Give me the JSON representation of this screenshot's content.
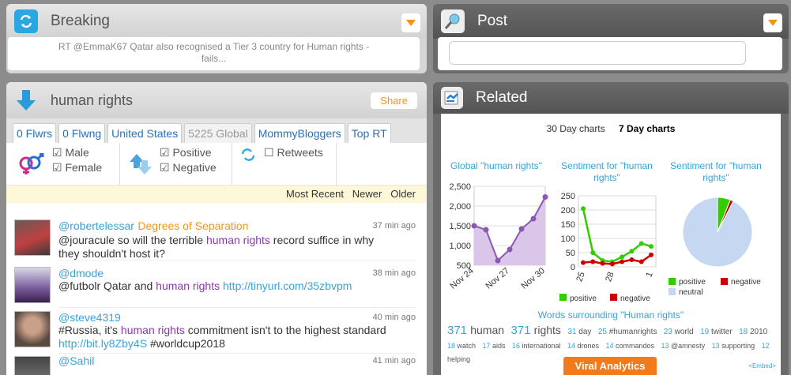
{
  "breaking": {
    "title": "Breaking",
    "text_line1": "RT @EmmaK67 Qatar also recognised a Tier 3 country for Human rights -",
    "text_line2": "fails..."
  },
  "post": {
    "title": "Post",
    "input_placeholder": ""
  },
  "stream": {
    "title": "human rights",
    "share": "Share",
    "tabs": [
      "0 Flwrs",
      "0 Flwng",
      "United States",
      "5225 Global",
      "MommyBloggers",
      "Top RT"
    ],
    "filters": {
      "male": "Male",
      "female": "Female",
      "positive": "Positive",
      "negative": "Negative",
      "retweets": "Retweets"
    },
    "sort": {
      "most_recent": "Most Recent",
      "newer": "Newer",
      "older": "Older"
    },
    "tweets": [
      {
        "user": "@robertelessar",
        "extra": "Degrees of Separation",
        "time": "37 min ago",
        "t1": "@jouracule so will the terrible ",
        "hl": "human rights",
        "t2": " record suffice in why",
        "line2": "they shouldn't host it?"
      },
      {
        "user": "@dmode",
        "time": "38 min ago",
        "t1": "@futbolr Qatar and ",
        "hl": "human rights",
        "link": "http://tinyurl.com/35zbvpm"
      },
      {
        "user": "@steve4319",
        "time": "40 min ago",
        "t1": "#Russia, it's ",
        "hl": "human rights",
        "t2": " commitment isn't to the highest standard",
        "link": "http://bit.ly8Zby4S",
        "t3": " #worldcup2018"
      },
      {
        "user": "@Sahil",
        "time": "41 min ago"
      }
    ]
  },
  "related": {
    "title": "Related",
    "tab_30": "30 Day charts",
    "tab_7": "7 Day charts",
    "words_title": "Words surrounding \"Human rights\"",
    "words": [
      {
        "n": "371",
        "w": "human",
        "size": "big"
      },
      {
        "n": "371",
        "w": "rights",
        "size": "big"
      },
      {
        "n": "31",
        "w": "day",
        "size": "med"
      },
      {
        "n": "25",
        "w": "#humanrights",
        "size": "med"
      },
      {
        "n": "23",
        "w": "world",
        "size": "med"
      },
      {
        "n": "19",
        "w": "twitter",
        "size": "med"
      },
      {
        "n": "18",
        "w": "2010",
        "size": "med"
      },
      {
        "n": "18",
        "w": "watch",
        "size": "sm"
      },
      {
        "n": "17",
        "w": "aids",
        "size": "sm"
      },
      {
        "n": "16",
        "w": "international",
        "size": "sm"
      },
      {
        "n": "14",
        "w": "drones",
        "size": "sm"
      },
      {
        "n": "14",
        "w": "commandos",
        "size": "sm"
      },
      {
        "n": "13",
        "w": "@amnesty",
        "size": "sm"
      },
      {
        "n": "13",
        "w": "supporting",
        "size": "sm"
      },
      {
        "n": "12",
        "w": "helping",
        "size": "sm"
      }
    ],
    "viral": "Viral Analytics",
    "embed": "<Embed>"
  },
  "chart_data": [
    {
      "type": "area",
      "title": "Global \"human rights\"",
      "x": [
        "Nov 24",
        "Nov 25",
        "Nov 26",
        "Nov 27",
        "Nov 28",
        "Nov 29",
        "Nov 30"
      ],
      "x_tick_labels": [
        "Nov 24",
        "Nov 27",
        "Nov 30"
      ],
      "values": [
        1500,
        1400,
        620,
        900,
        1420,
        1680,
        2230
      ],
      "ylim": [
        500,
        2500
      ],
      "yticks": [
        500,
        1000,
        1500,
        2000,
        2500
      ],
      "ytick_labels": [
        "500",
        "1,000",
        "1,500",
        "2,000",
        "2,500"
      ],
      "color": "#8e56b4"
    },
    {
      "type": "line",
      "title": "Sentiment for \"human rights\"",
      "x_tick_labels": [
        "25",
        "28",
        "1"
      ],
      "ylim": [
        0,
        250
      ],
      "yticks": [
        0,
        50,
        100,
        150,
        200,
        250
      ],
      "series": [
        {
          "name": "positive",
          "color": "#33cc00",
          "values": [
            205,
            50,
            22,
            18,
            35,
            55,
            82,
            72
          ]
        },
        {
          "name": "negative",
          "color": "#cc0000",
          "values": [
            15,
            18,
            12,
            10,
            18,
            25,
            18,
            42
          ]
        }
      ]
    },
    {
      "type": "pie",
      "title": "Sentiment for \"human rights\"",
      "slices": [
        {
          "name": "positive",
          "value": 6,
          "color": "#33cc00"
        },
        {
          "name": "negative",
          "value": 1.5,
          "color": "#cc0000"
        },
        {
          "name": "neutral",
          "value": 92.5,
          "color": "#c6d7f2"
        }
      ]
    }
  ]
}
